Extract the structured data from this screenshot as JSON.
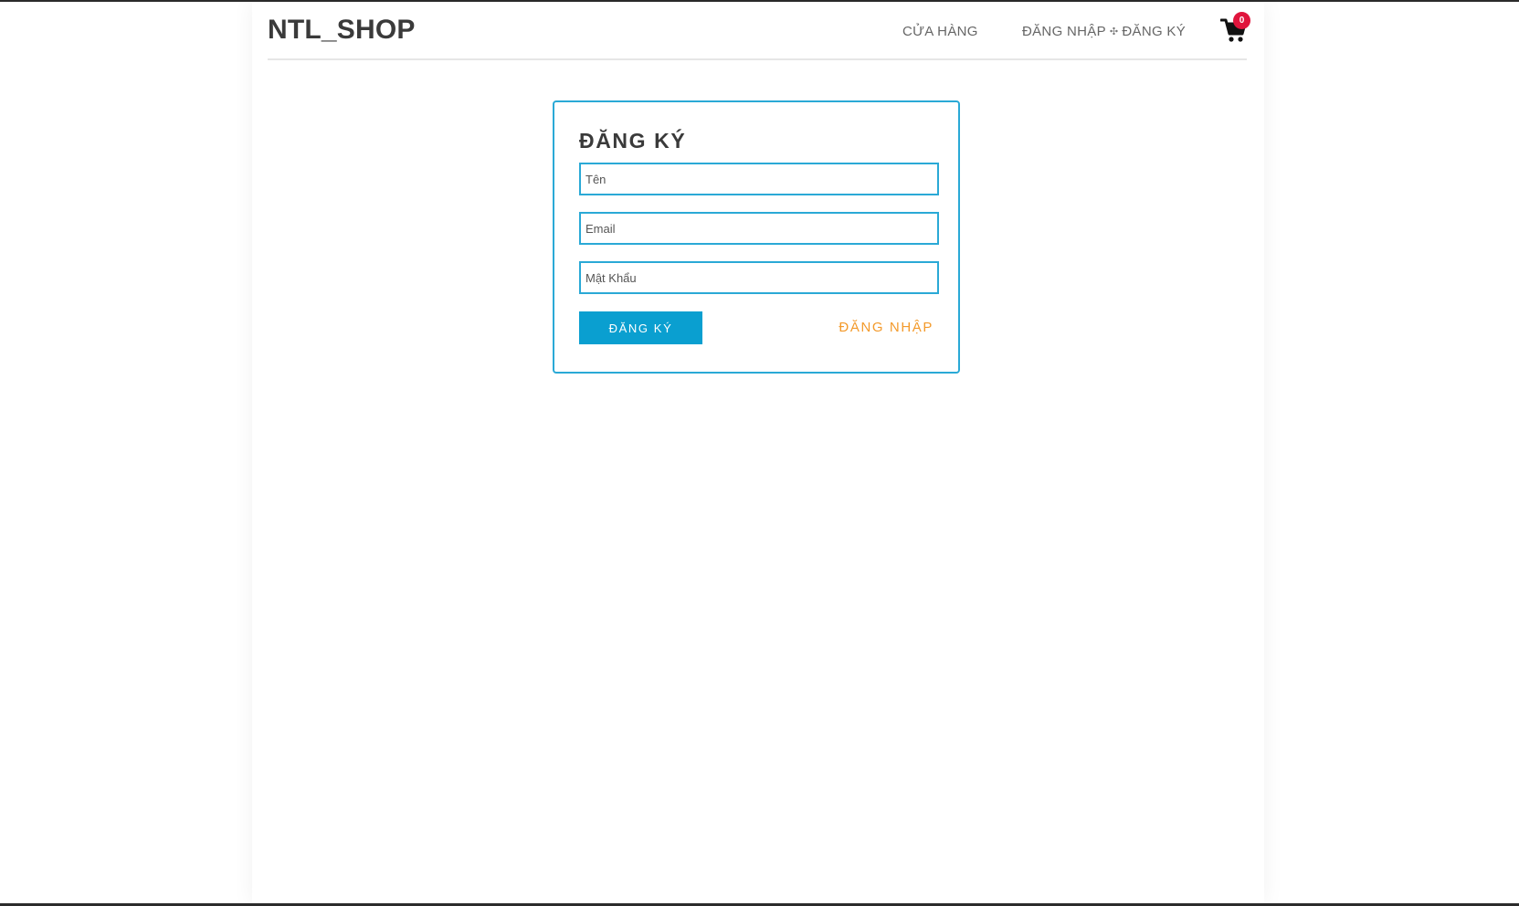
{
  "header": {
    "logo": "NTL_SHOP",
    "nav": {
      "store": "CỬA HÀNG",
      "login": "ĐĂNG NHẬP",
      "separator": "✣",
      "register": "ĐĂNG KÝ"
    },
    "cart": {
      "icon": "shopping-cart-icon",
      "count": "0"
    }
  },
  "register_form": {
    "title": "ĐĂNG KÝ",
    "name_placeholder": "Tên",
    "email_placeholder": "Email",
    "password_placeholder": "Mật Khẩu",
    "submit_label": "ĐĂNG KÝ",
    "login_link": "ĐĂNG NHẬP"
  },
  "colors": {
    "accent": "#0a9fd0",
    "border": "#2aa9d6",
    "link": "#f39a2b",
    "badge": "#e0143c"
  }
}
